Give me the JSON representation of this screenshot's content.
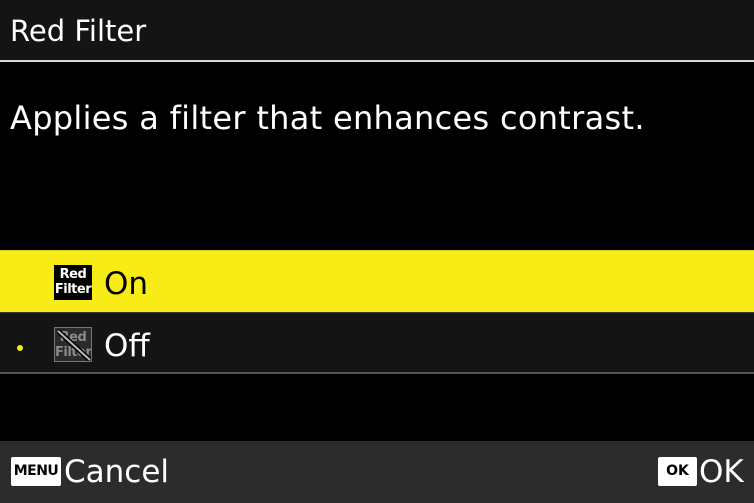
{
  "header": {
    "title": "Red Filter"
  },
  "description": "Applies a filter that enhances contrast.",
  "options": [
    {
      "label": "On",
      "icon_line1": "Red",
      "icon_line2": "Filter",
      "icon": "red-filter-on-icon",
      "highlighted": true
    },
    {
      "label": "Off",
      "icon_line1": "Red",
      "icon_line2": "Filter",
      "icon": "red-filter-off-icon",
      "current": true
    }
  ],
  "footer": {
    "menu_key": "MENU",
    "cancel_label": "Cancel",
    "ok_key": "OK",
    "ok_label": "OK"
  },
  "colors": {
    "highlight": "#f8ec16",
    "background": "#000000",
    "header_bg": "#141414",
    "footer_bg": "#2c2c2c"
  }
}
